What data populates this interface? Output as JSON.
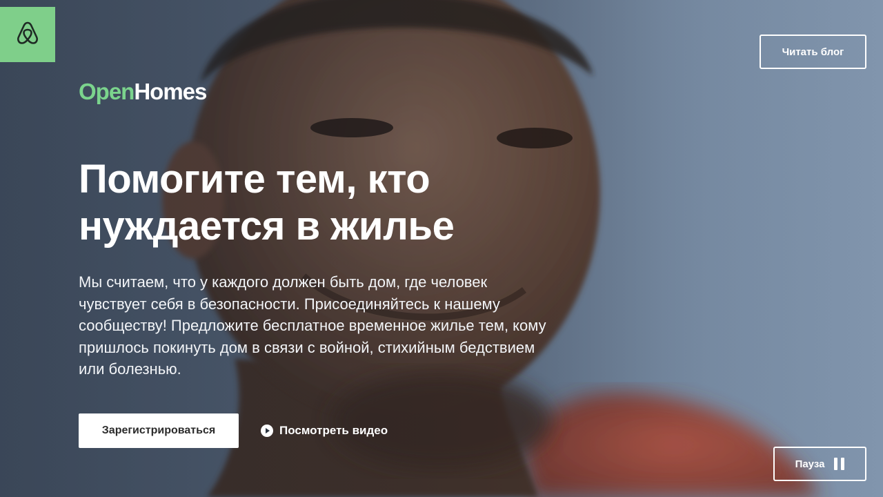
{
  "brand": {
    "logo_icon": "airbnb-belo-icon",
    "wordmark_part1": "Open",
    "wordmark_part2": "Homes",
    "accent_color": "#7bd48d",
    "tile_color": "#7fcf8a"
  },
  "header": {
    "blog_button_label": "Читать блог"
  },
  "hero": {
    "headline": "Помогите тем, кто нуждается в жилье",
    "description": "Мы считаем, что у каждого должен быть дом, где человек чувствует себя в безопасности. Присоединяйтесь к нашему сообществу! Предложите бесплатное временное жилье тем, кому пришлось покинуть дом в связи с войной, стихийным бедствием или болезнью.",
    "register_button_label": "Зарегистрироваться",
    "watch_video_label": "Посмотреть видео",
    "watch_video_icon": "play-circle-icon"
  },
  "video_controls": {
    "pause_label": "Пауза",
    "pause_icon": "pause-icon"
  }
}
